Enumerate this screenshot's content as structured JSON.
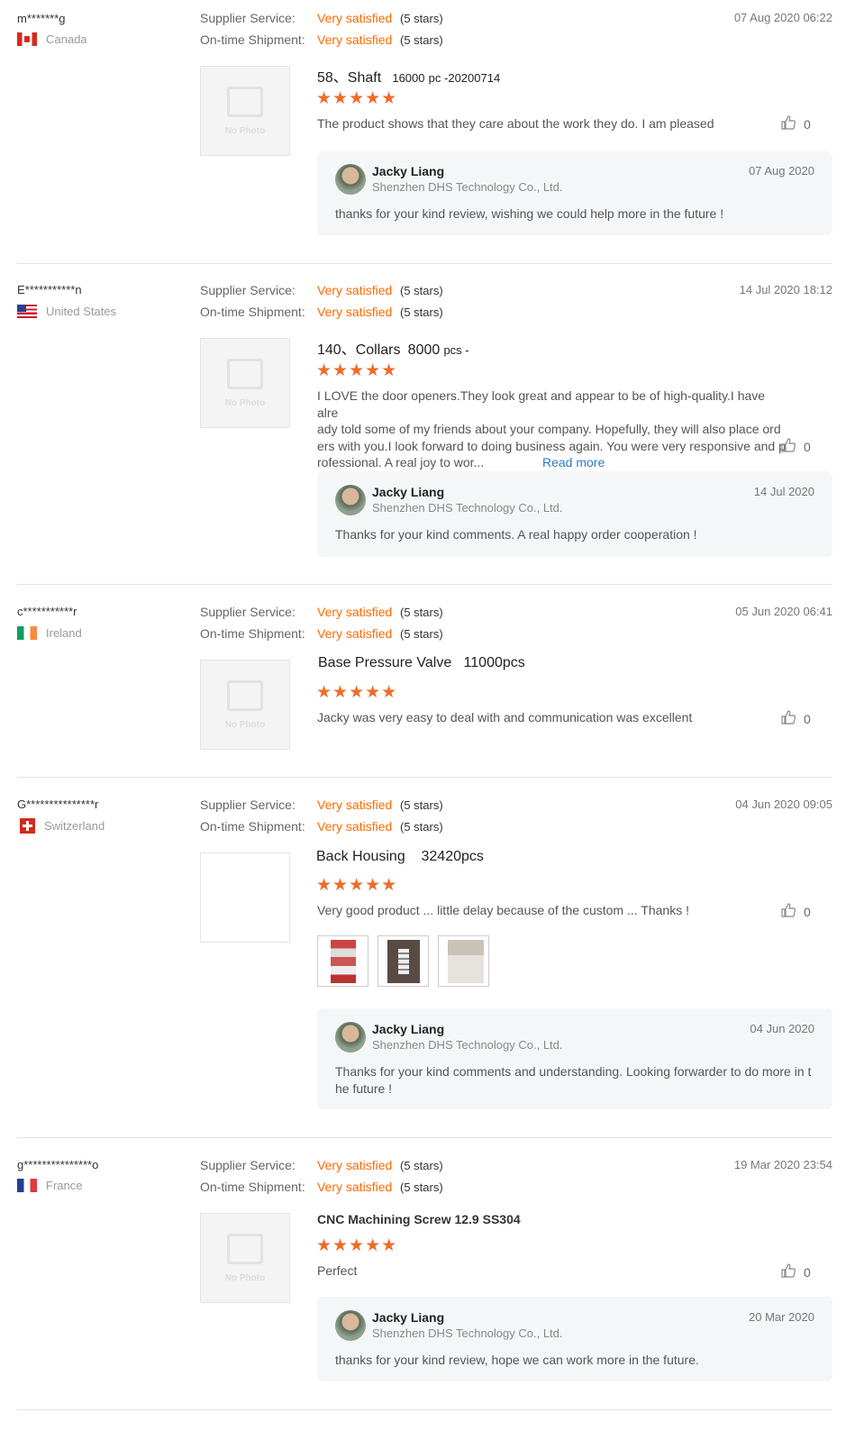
{
  "labels": {
    "supplier_service": "Supplier Service:",
    "ontime_shipment": "On-time Shipment:",
    "no_photo": "No Photo",
    "stars_glyphs": "★★★★★"
  },
  "reviews": [
    {
      "user": "m*******g",
      "country": "Canada",
      "supplier_value": "Very satisfied",
      "supplier_stars": "(5 stars)",
      "shipment_value": "Very satisfied",
      "shipment_stars": "(5 stars)",
      "date": "07 Aug 2020 06:22",
      "product_a": "58、Shaft",
      "product_b": "16000",
      "product_c": "pc -20200714",
      "rating": 5,
      "comment": "The product shows that they care about the work they do. I am pleased",
      "likes": "0",
      "reply": {
        "name": "Jacky Liang",
        "company": "Shenzhen DHS Technology Co., Ltd.",
        "date": "07 Aug 2020",
        "text": "thanks for your kind review, wishing we could help more in the future !"
      }
    },
    {
      "user": "E***********n",
      "country": "United States",
      "supplier_value": "Very satisfied",
      "supplier_stars": "(5 stars)",
      "shipment_value": "Very satisfied",
      "shipment_stars": "(5 stars)",
      "date": "14 Jul 2020 18:12",
      "product_a": "140、Collars",
      "product_b": "8000",
      "product_c": "pcs -",
      "rating": 5,
      "comment_lines": [
        "I LOVE the door openers.They look great and appear to be of high-quality.I have alre",
        "ady told some of my friends about your company. Hopefully, they will also place ord",
        "ers with you.I look forward to doing business again. You were very responsive and p",
        "rofessional. A real joy to wor..."
      ],
      "read_more": "Read more",
      "likes": "0",
      "reply": {
        "name": "Jacky Liang",
        "company": "Shenzhen DHS Technology Co., Ltd.",
        "date": "14 Jul 2020",
        "text": "Thanks for your kind comments. A real happy order cooperation !"
      }
    },
    {
      "user": "c***********r",
      "country": "Ireland",
      "supplier_value": "Very satisfied",
      "supplier_stars": "(5 stars)",
      "shipment_value": "Very satisfied",
      "shipment_stars": "(5 stars)",
      "date": "05 Jun 2020 06:41",
      "product": "Base Pressure Valve   11000pcs",
      "rating": 5,
      "comment": "Jacky was very easy to deal with and communication was excellent",
      "likes": "0"
    },
    {
      "user": "G***************r",
      "country": "Switzerland",
      "supplier_value": "Very satisfied",
      "supplier_stars": "(5 stars)",
      "shipment_value": "Very satisfied",
      "shipment_stars": "(5 stars)",
      "date": "04 Jun 2020 09:05",
      "product": "Back Housing    32420pcs",
      "rating": 5,
      "comment": "Very good product ... little delay because of the custom ... Thanks !",
      "likes": "0",
      "reply": {
        "name": "Jacky Liang",
        "company": "Shenzhen DHS Technology Co., Ltd.",
        "date": "04 Jun 2020",
        "text_lines": [
          "Thanks for your kind comments and understanding. Looking forwarder to do more in t",
          "he future !"
        ]
      }
    },
    {
      "user": "g***************o",
      "country": "France",
      "supplier_value": "Very satisfied",
      "supplier_stars": "(5 stars)",
      "shipment_value": "Very satisfied",
      "shipment_stars": "(5 stars)",
      "date": "19 Mar 2020 23:54",
      "product": "CNC Machining Screw 12.9 SS304",
      "rating": 5,
      "comment": "Perfect",
      "likes": "0",
      "reply": {
        "name": "Jacky Liang",
        "company": "Shenzhen DHS Technology Co., Ltd.",
        "date": "20 Mar 2020",
        "text": "thanks for your kind review, hope we can work more in the future."
      }
    }
  ]
}
